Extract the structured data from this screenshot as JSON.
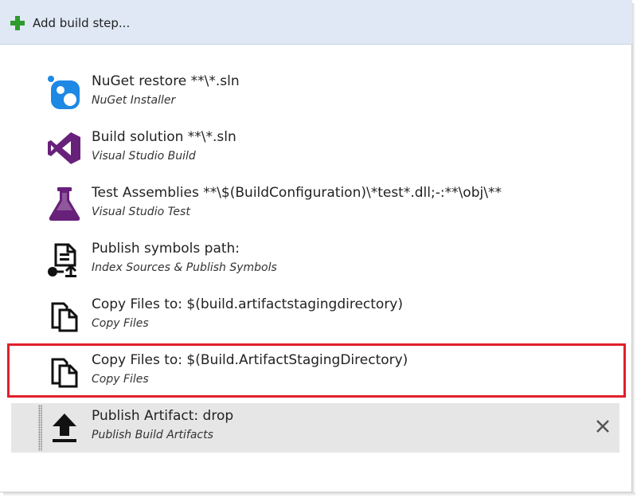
{
  "toolbar": {
    "add_step_label": "Add build step..."
  },
  "steps": [
    {
      "title": "NuGet restore **\\*.sln",
      "subtitle": "NuGet Installer",
      "icon": "nuget-icon"
    },
    {
      "title": "Build solution **\\*.sln",
      "subtitle": "Visual Studio Build",
      "icon": "visual-studio-icon"
    },
    {
      "title": "Test Assemblies **\\$(BuildConfiguration)\\*test*.dll;-:**\\obj\\**",
      "subtitle": "Visual Studio Test",
      "icon": "flask-icon"
    },
    {
      "title": "Publish symbols path:",
      "subtitle": "Index Sources & Publish Symbols",
      "icon": "publish-symbols-icon"
    },
    {
      "title": "Copy Files to: $(build.artifactstagingdirectory)",
      "subtitle": "Copy Files",
      "icon": "copy-files-icon"
    },
    {
      "title": "Copy Files to: $(Build.ArtifactStagingDirectory)",
      "subtitle": "Copy Files",
      "icon": "copy-files-icon"
    },
    {
      "title": "Publish Artifact: drop",
      "subtitle": "Publish Build Artifacts",
      "icon": "upload-icon"
    }
  ],
  "colors": {
    "toolbar_bg": "#dfe8f4",
    "highlight": "#e0202a",
    "selected_bg": "#e6e6e6",
    "add_plus": "#2e9b2e",
    "nuget": "#1e88e5",
    "visual_studio": "#68217a"
  }
}
